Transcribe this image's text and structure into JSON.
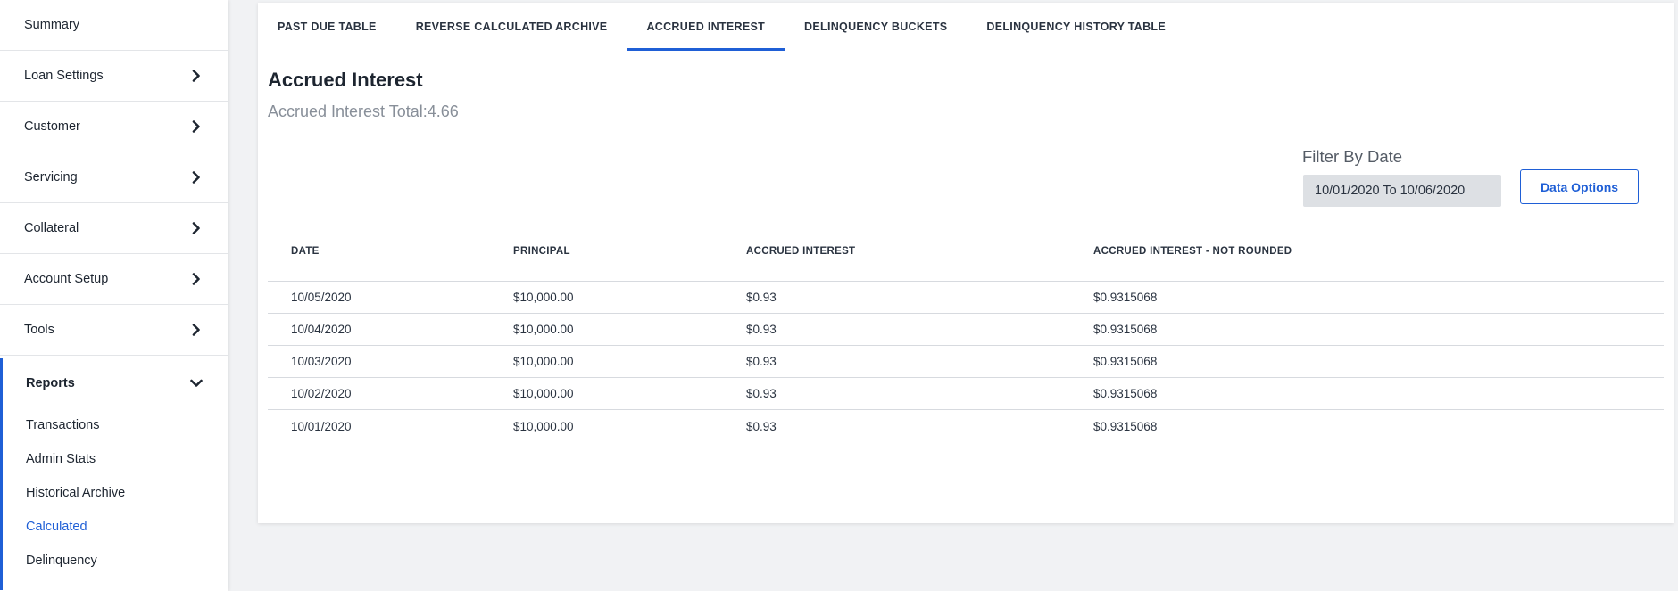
{
  "sidebar": {
    "items": [
      {
        "label": "Summary",
        "chevron": false
      },
      {
        "label": "Loan Settings",
        "chevron": true
      },
      {
        "label": "Customer",
        "chevron": true
      },
      {
        "label": "Servicing",
        "chevron": true
      },
      {
        "label": "Collateral",
        "chevron": true
      },
      {
        "label": "Account Setup",
        "chevron": true
      },
      {
        "label": "Tools",
        "chevron": true
      }
    ],
    "reports": {
      "label": "Reports",
      "subitems": [
        {
          "label": "Transactions"
        },
        {
          "label": "Admin Stats"
        },
        {
          "label": "Historical Archive"
        },
        {
          "label": "Calculated",
          "active": true
        },
        {
          "label": "Delinquency"
        }
      ]
    }
  },
  "tabs": [
    {
      "label": "PAST DUE TABLE"
    },
    {
      "label": "REVERSE CALCULATED ARCHIVE"
    },
    {
      "label": "ACCRUED INTEREST",
      "active": true
    },
    {
      "label": "DELINQUENCY BUCKETS"
    },
    {
      "label": "DELINQUENCY HISTORY TABLE"
    }
  ],
  "main": {
    "title": "Accrued Interest",
    "total_text": "Accrued Interest Total:4.66",
    "filter_label": "Filter By Date",
    "date_range": "10/01/2020 To 10/06/2020",
    "data_options_label": "Data Options"
  },
  "table": {
    "columns": [
      "DATE",
      "PRINCIPAL",
      "ACCRUED INTEREST",
      "ACCRUED INTEREST - NOT ROUNDED"
    ],
    "rows": [
      [
        "10/05/2020",
        "$10,000.00",
        "$0.93",
        "$0.9315068"
      ],
      [
        "10/04/2020",
        "$10,000.00",
        "$0.93",
        "$0.9315068"
      ],
      [
        "10/03/2020",
        "$10,000.00",
        "$0.93",
        "$0.9315068"
      ],
      [
        "10/02/2020",
        "$10,000.00",
        "$0.93",
        "$0.9315068"
      ],
      [
        "10/01/2020",
        "$10,000.00",
        "$0.93",
        "$0.9315068"
      ]
    ]
  },
  "colors": {
    "accent": "#1f5fd6",
    "background": "#f1f2f4",
    "panel": "#ffffff"
  },
  "icons": {
    "collapsed": "chevron-right-icon",
    "expanded": "chevron-down-icon"
  }
}
